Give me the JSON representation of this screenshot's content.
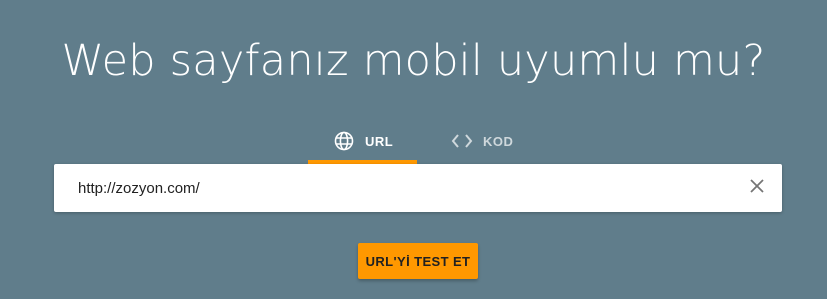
{
  "headline": "Web sayfanız mobil uyumlu mu?",
  "tabs": [
    {
      "label": "URL",
      "icon": "globe-icon",
      "active": true
    },
    {
      "label": "KOD",
      "icon": "code-icon",
      "active": false
    }
  ],
  "search": {
    "value": "http://zozyon.com/",
    "clear_icon": "close-icon"
  },
  "test_button": {
    "label": "URL'Yİ TEST ET"
  },
  "colors": {
    "background": "#607d8b",
    "accent": "#ff9800",
    "active_tab_text": "#ffffff",
    "inactive_tab_text": "#cfd8dc"
  }
}
